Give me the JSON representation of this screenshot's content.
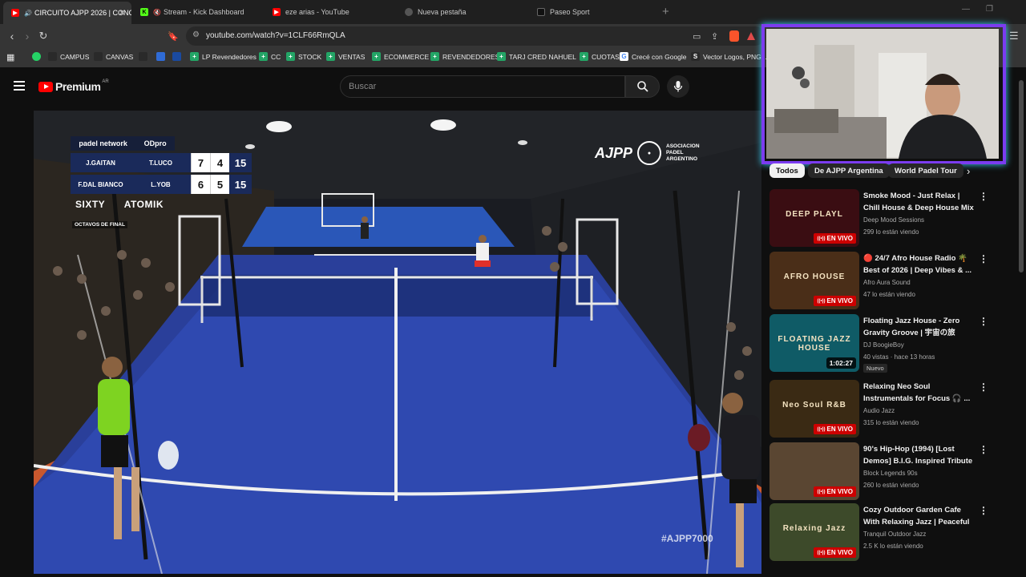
{
  "browser": {
    "tabs": [
      {
        "title": "CIRCUITO AJPP 2026 | CONC",
        "active": true,
        "favicon": "youtube-icon",
        "color": "#ff0000"
      },
      {
        "title": "Stream - Kick Dashboard",
        "active": false,
        "favicon": "kick-icon",
        "color": "#53fc18"
      },
      {
        "title": "eze arias - YouTube",
        "active": false,
        "favicon": "youtube-icon",
        "color": "#ff0000"
      },
      {
        "title": "Nueva pestaña",
        "active": false,
        "favicon": "brave-icon",
        "color": "#888888"
      },
      {
        "title": "Paseo Sport",
        "active": false,
        "favicon": "paseo-icon",
        "color": "#222222"
      }
    ],
    "url": "youtube.com/watch?v=1CLF66RmQLA",
    "bookmarks": [
      {
        "label": "",
        "icon": "whatsapp-icon",
        "color": "#25d366"
      },
      {
        "label": "CAMPUS",
        "icon": "campus-icon",
        "color": "#2a2a2a"
      },
      {
        "label": "CANVAS",
        "icon": "canvas-icon",
        "color": "#2a2a2a"
      },
      {
        "label": "",
        "icon": "bookmark-icon",
        "color": "#2a2a2a"
      },
      {
        "label": "",
        "icon": "bookmark-icon",
        "color": "#2f6bd6"
      },
      {
        "label": "",
        "icon": "bookmark-icon",
        "color": "#1a4aa0"
      },
      {
        "label": "LP Revendedores",
        "icon": "sheets-icon",
        "color": "#23a566"
      },
      {
        "label": "CC",
        "icon": "sheets-icon",
        "color": "#23a566"
      },
      {
        "label": "STOCK",
        "icon": "sheets-icon",
        "color": "#23a566"
      },
      {
        "label": "VENTAS",
        "icon": "sheets-icon",
        "color": "#23a566"
      },
      {
        "label": "ECOMMERCE",
        "icon": "sheets-icon",
        "color": "#23a566"
      },
      {
        "label": "REVENDEDORES",
        "icon": "sheets-icon",
        "color": "#23a566"
      },
      {
        "label": "TARJ CRED NAHUEL",
        "icon": "sheets-icon",
        "color": "#23a566"
      },
      {
        "label": "CUOTAS",
        "icon": "sheets-icon",
        "color": "#23a566"
      },
      {
        "label": "Crecé con Google",
        "icon": "google-icon",
        "color": "#ffffff"
      },
      {
        "label": "Vector Logos, PNG I...",
        "icon": "s-icon",
        "color": "#2a2a2a"
      }
    ]
  },
  "youtube": {
    "brand": "Premium",
    "country": "AR",
    "search_placeholder": "Buscar"
  },
  "scoreboard": {
    "brand_left": "padel network",
    "brand_right": "ODpro",
    "team1": {
      "p1": "J.GAITAN",
      "p2": "T.LUCO",
      "set1": "7",
      "set2": "4",
      "points": "15"
    },
    "team2": {
      "p1": "F.DAL BIANCO",
      "p2": "L.YOB",
      "set1": "6",
      "set2": "5",
      "points": "15"
    },
    "sponsor1": "SIXTY",
    "sponsor2": "ATOMIK",
    "round": "OCTAVOS DE FINAL"
  },
  "overlay": {
    "ajpp": "AJPP",
    "ajpp_sub": "ARGENTINA",
    "assoc": [
      "ASOCIACION",
      "PADEL",
      "ARGENTINO"
    ],
    "hashtag": "#AJPP7000"
  },
  "sidebar": {
    "chips": [
      "Todos",
      "De AJPP Argentina",
      "World Padel Tour"
    ],
    "items": [
      {
        "title": "Smoke Mood - Just Relax | Chill House & Deep House Mix 🎧 ...",
        "channel": "Deep Mood Sessions",
        "meta": "299 lo están viendo",
        "badge": "EN VIVO",
        "thumb_color": "#3a0d12",
        "thumb_text": "DEEP PLAYL"
      },
      {
        "title": "🔴 24/7 Afro House Radio 🌴 Best of 2026 | Deep Vibes & ...",
        "channel": "Afro Aura Sound",
        "meta": "47 lo están viendo",
        "badge": "EN VIVO",
        "thumb_color": "#4a2e18",
        "thumb_text": "AFRO HOUSE"
      },
      {
        "title": "Floating Jazz House - Zero Gravity Groove | 宇宙の旅 Spa...",
        "channel": "DJ BoogieBoy",
        "meta": "40 vistas · hace 13 horas",
        "badge": "1:02:27",
        "extra": "Nuevo",
        "thumb_color": "#0f5b66",
        "thumb_text": "FLOATING JAZZ HOUSE"
      },
      {
        "title": "Relaxing Neo Soul Instrumentals for Focus 🎧 ...",
        "channel": "Audio Jazz",
        "meta": "315 lo están viendo",
        "badge": "EN VIVO",
        "thumb_color": "#3a2a14",
        "thumb_text": "Neo Soul R&B"
      },
      {
        "title": "90's Hip-Hop (1994) [Lost Demos] B.I.G. Inspired Tribute ...",
        "channel": "Block Legends 90s",
        "meta": "260 lo están viendo",
        "badge": "EN VIVO",
        "thumb_color": "#5a4632",
        "thumb_text": ""
      },
      {
        "title": "Cozy Outdoor Garden Cafe With Relaxing Jazz | Peaceful ...",
        "channel": "Tranquil Outdoor Jazz",
        "meta": "2.5 K lo están viendo",
        "badge": "EN VIVO",
        "thumb_color": "#3d4a2a",
        "thumb_text": "Relaxing Jazz"
      }
    ]
  }
}
